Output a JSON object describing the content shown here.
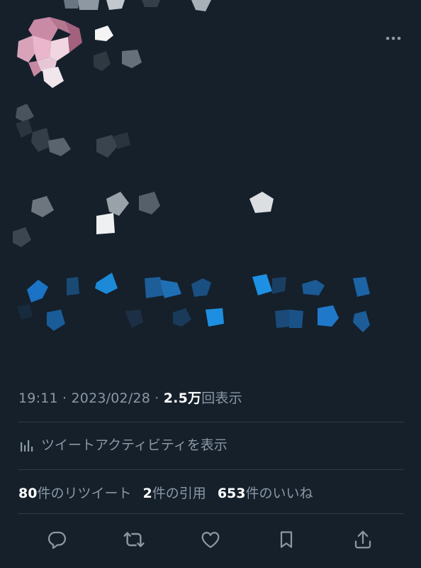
{
  "tweet": {
    "time": "19:11",
    "separator": "·",
    "date": "2023/02/28",
    "views_count": "2.5万",
    "views_label": "回表示",
    "activity_label": "ツイートアクティビティを表示"
  },
  "stats": {
    "retweets_count": "80",
    "retweets_label": "件のリツイート",
    "quotes_count": "2",
    "quotes_label": "件の引用",
    "likes_count": "653",
    "likes_label": "件のいいね"
  },
  "icons": {
    "more": "more-icon",
    "analytics": "bar-chart-icon",
    "reply": "reply-icon",
    "retweet": "retweet-icon",
    "like": "heart-icon",
    "bookmark": "bookmark-icon",
    "share": "share-icon"
  },
  "colors": {
    "background": "#15202b",
    "text_secondary": "#8b98a5",
    "text_primary": "#ffffff",
    "divider": "#2f3b47",
    "icon": "#8b98a5"
  }
}
